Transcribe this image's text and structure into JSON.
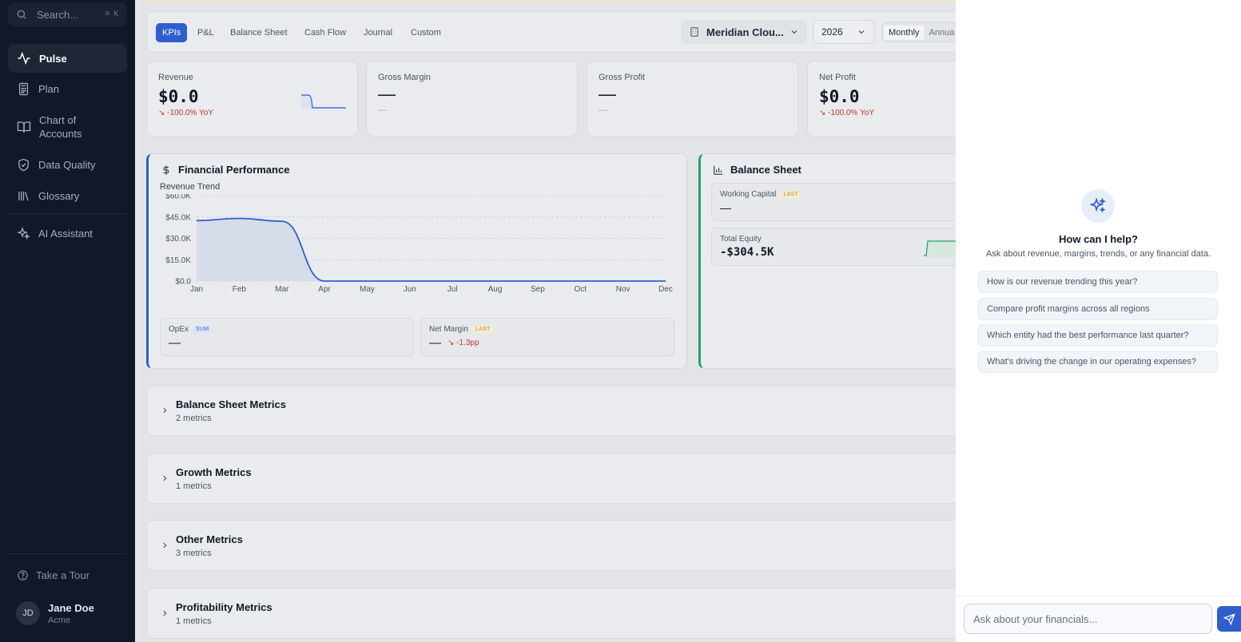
{
  "sidebar": {
    "search_placeholder": "Search...",
    "search_shortcut": "⌘ K",
    "items": [
      {
        "label": "Pulse",
        "icon": "pulse-icon"
      },
      {
        "label": "Plan",
        "icon": "calculator-icon"
      },
      {
        "label": "Chart of Accounts",
        "icon": "book-icon"
      },
      {
        "label": "Data Quality",
        "icon": "shield-check-icon"
      },
      {
        "label": "Glossary",
        "icon": "library-icon"
      },
      {
        "label": "AI Assistant",
        "icon": "sparkles-icon"
      }
    ],
    "chart_line1": "Chart of",
    "chart_line2": "Accounts",
    "tour": "Take a Tour",
    "user": {
      "initials": "JD",
      "name": "Jane Doe",
      "org": "Acme"
    }
  },
  "toolbar": {
    "tabs": [
      "KPIs",
      "P&L",
      "Balance Sheet",
      "Cash Flow",
      "Journal",
      "Custom"
    ],
    "active_tab": "KPIs",
    "entity": "Meridian Clou...",
    "year": "2026",
    "period_options": [
      "Monthly",
      "Annua"
    ],
    "period_selected": "Monthly"
  },
  "kpis": [
    {
      "label": "Revenue",
      "value": "$0.0",
      "yoy": "-100.0% YoY"
    },
    {
      "label": "Gross Margin",
      "value": "—",
      "sub": "—"
    },
    {
      "label": "Gross Profit",
      "value": "—",
      "sub": "—"
    },
    {
      "label": "Net Profit",
      "value": "$0.0",
      "yoy": "-100.0% YoY"
    }
  ],
  "financial_performance": {
    "title": "Financial Performance",
    "subtitle": "Revenue Trend",
    "opex": {
      "label": "OpEx",
      "badge": "SUM",
      "value": "—"
    },
    "net_margin": {
      "label": "Net Margin",
      "badge": "LAST",
      "value": "—",
      "delta": "-1.3pp"
    }
  },
  "chart_data": {
    "type": "area",
    "title": "Revenue Trend",
    "categories": [
      "Jan",
      "Feb",
      "Mar",
      "Apr",
      "May",
      "Jun",
      "Jul",
      "Aug",
      "Sep",
      "Oct",
      "Nov",
      "Dec"
    ],
    "values": [
      42500,
      44000,
      42000,
      0,
      0,
      0,
      0,
      0,
      0,
      0,
      0,
      0
    ],
    "yticks": [
      "$60.0K",
      "$45.0K",
      "$30.0K",
      "$15.0K",
      "$0.0"
    ],
    "ylim": [
      0,
      60000
    ],
    "grid": true,
    "color": "#2f5fcc"
  },
  "balance_sheet": {
    "title": "Balance Sheet",
    "working_capital": {
      "label": "Working Capital",
      "badge": "LAST",
      "value": "—"
    },
    "total_equity": {
      "label": "Total Equity",
      "value": "-$304.5K"
    }
  },
  "groups": [
    {
      "title": "Balance Sheet Metrics",
      "count": "2 metrics"
    },
    {
      "title": "Growth Metrics",
      "count": "1 metrics"
    },
    {
      "title": "Other Metrics",
      "count": "3 metrics"
    },
    {
      "title": "Profitability Metrics",
      "count": "1 metrics"
    }
  ],
  "assistant": {
    "heading": "How can I help?",
    "subheading": "Ask about revenue, margins, trends, or any financial data.",
    "suggestions": [
      "How is our revenue trending this year?",
      "Compare profit margins across all regions",
      "Which entity had the best performance last quarter?",
      "What's driving the change in our operating expenses?"
    ],
    "input_placeholder": "Ask about your financials..."
  },
  "colors": {
    "accent": "#2f5fcc",
    "positive": "#21a36b",
    "negative": "#c0392b",
    "sidebar": "#111827"
  }
}
